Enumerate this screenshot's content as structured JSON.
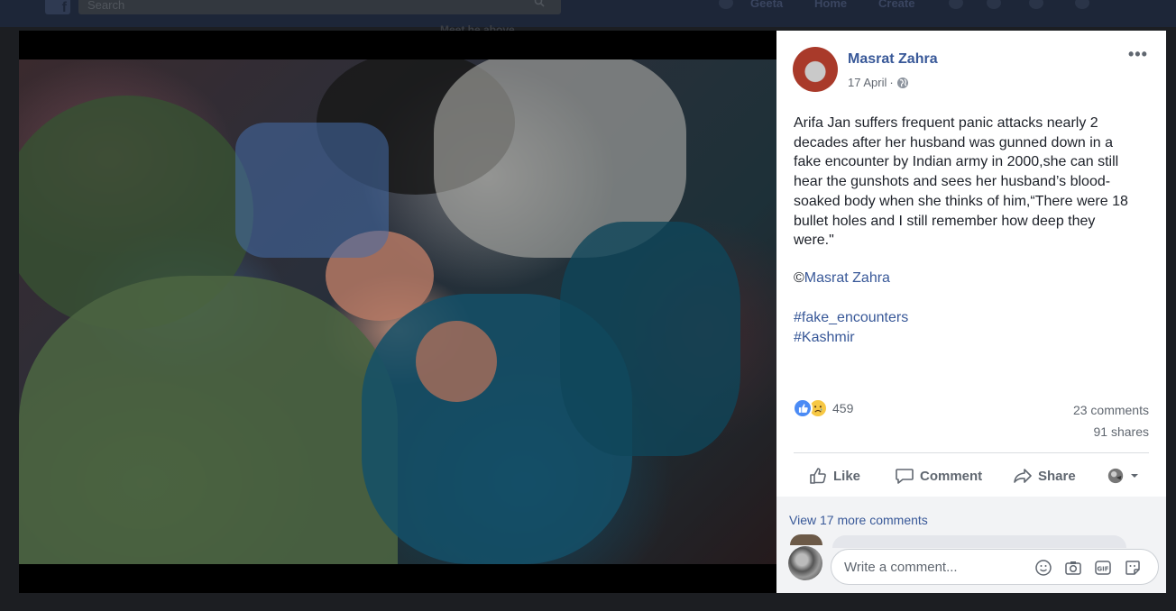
{
  "topbar": {
    "search_placeholder": "Search",
    "profile_name": "Geeta",
    "nav_home": "Home",
    "nav_create": "Create"
  },
  "background_header_text": "Meet  he above",
  "post": {
    "author": "Masrat Zahra",
    "date": "17 April",
    "date_separator": "·",
    "more_label": "•••",
    "text_lines": [
      "Arifa Jan suffers frequent panic attacks nearly 2",
      "decades after her husband was gunned down in a",
      "fake encounter by Indian army in 2000,she can still",
      "hear the gunshots and sees her husband’s blood-",
      "soaked body when she thinks of him,“There were 18",
      "bullet holes and I still remember how deep they",
      "were.\""
    ],
    "credit_symbol": "©",
    "credit_name": "Masrat Zahra",
    "hashtags": [
      "#fake_encounters",
      "#Kashmir"
    ],
    "reaction_count": "459",
    "comments_count": "23 comments",
    "shares_count": "91 shares"
  },
  "actions": {
    "like": "Like",
    "comment": "Comment",
    "share": "Share"
  },
  "comments": {
    "view_more": "View 17 more comments",
    "input_placeholder": "Write a comment..."
  },
  "icons": {
    "reaction_like": "like-reaction-icon",
    "reaction_sad": "sad-reaction-icon",
    "globe": "globe-icon",
    "emoji": "emoji-icon",
    "camera": "camera-icon",
    "gif": "gif-icon",
    "sticker": "sticker-icon"
  },
  "colors": {
    "link_blue": "#385898",
    "like_blue": "#4b8bf5",
    "sad_yellow": "#f7c844",
    "text_dark": "#1d2129",
    "text_gray": "#606770"
  }
}
